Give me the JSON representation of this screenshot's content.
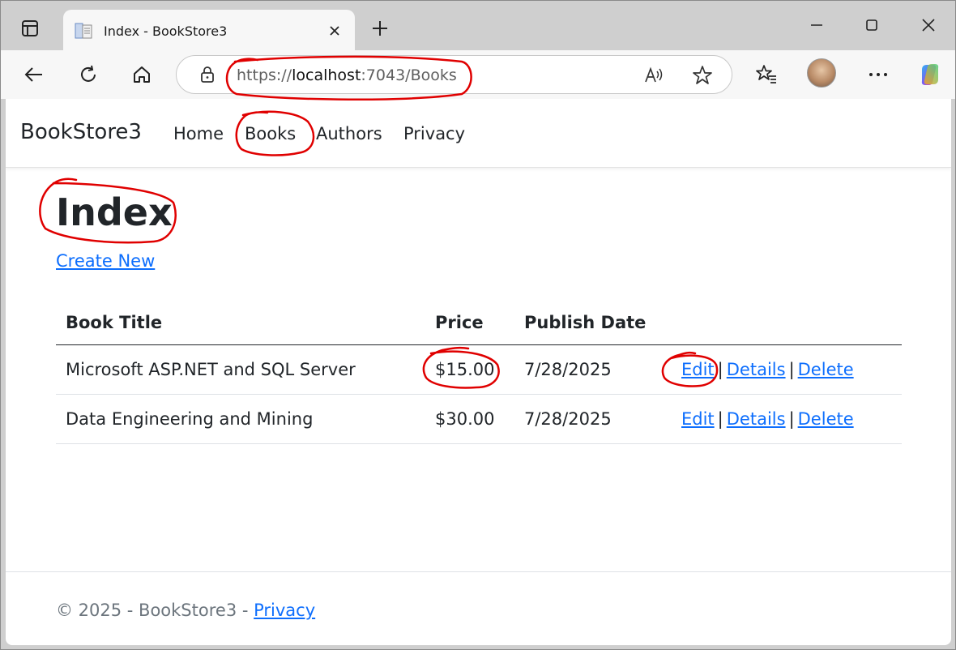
{
  "tab": {
    "title": "Index - BookStore3"
  },
  "address": {
    "scheme": "https://",
    "host": "localhost",
    "rest": ":7043/Books"
  },
  "site": {
    "brand": "BookStore3",
    "nav": [
      "Home",
      "Books",
      "Authors",
      "Privacy"
    ]
  },
  "page": {
    "title": "Index",
    "create_link": "Create New"
  },
  "table": {
    "headers": [
      "Book Title",
      "Price",
      "Publish Date"
    ],
    "rows": [
      {
        "title": "Microsoft ASP.NET and SQL Server",
        "price": "$15.00",
        "date": "7/28/2025"
      },
      {
        "title": "Data Engineering and Mining",
        "price": "$30.00",
        "date": "7/28/2025"
      }
    ],
    "actions": {
      "edit": "Edit",
      "details": "Details",
      "delete": "Delete",
      "separator": "|"
    }
  },
  "footer": {
    "text": "© 2025 - BookStore3 - ",
    "privacy": "Privacy"
  },
  "colors": {
    "link": "#0d6efd",
    "text": "#212529",
    "annotation": "#e00000",
    "chrome": "#cfcfcf"
  },
  "icons": [
    "sidebar-icon",
    "page-favicon-icon",
    "close-icon",
    "plus-icon",
    "minimize-icon",
    "maximize-icon",
    "window-close-icon",
    "back-arrow-icon",
    "refresh-icon",
    "home-icon",
    "lock-icon",
    "read-aloud-icon",
    "star-icon",
    "favorites-icon",
    "more-icon",
    "copilot-icon"
  ]
}
